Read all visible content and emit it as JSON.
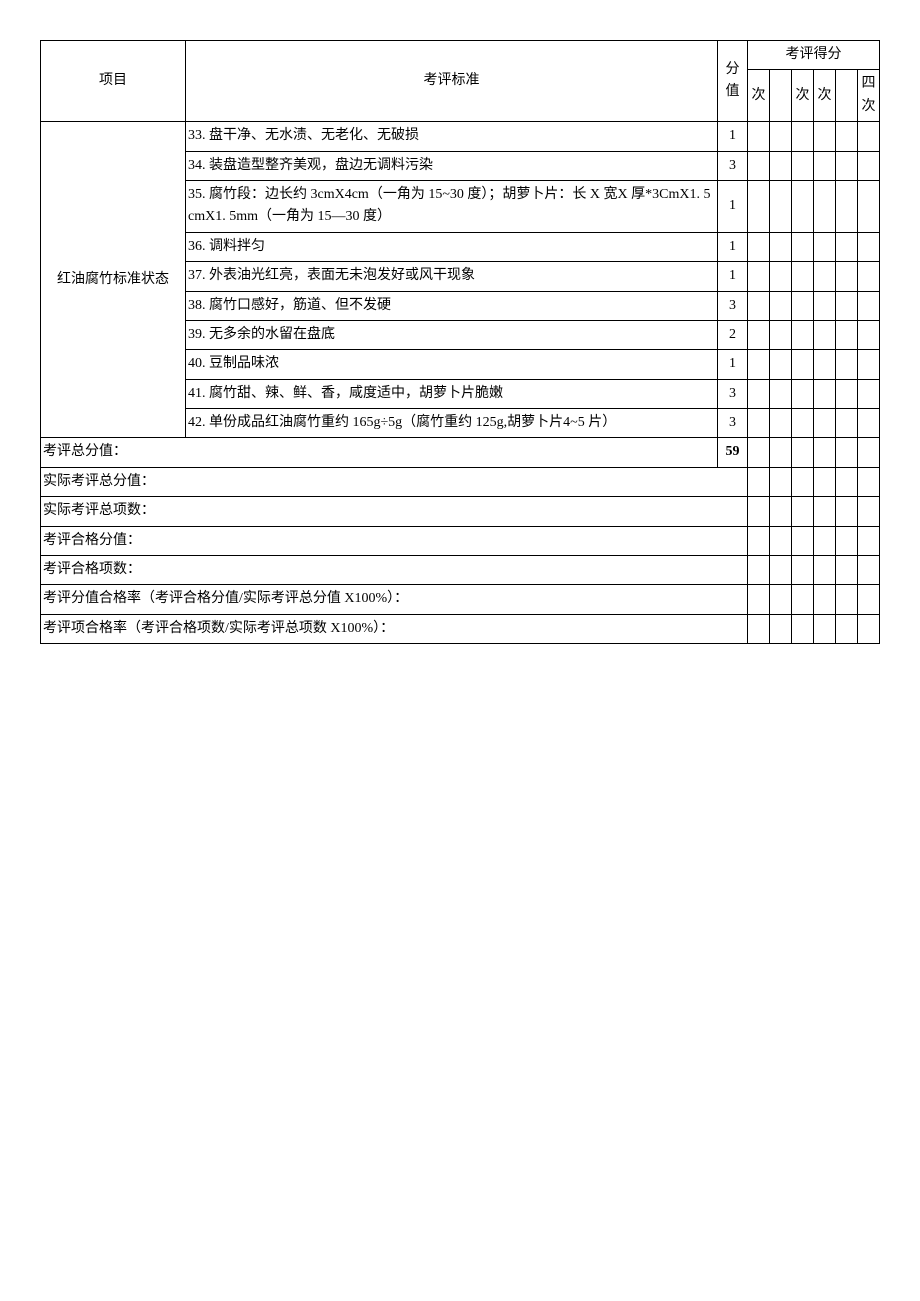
{
  "header": {
    "project": "项目",
    "standard": "考评标准",
    "score": "分值",
    "scoreGroup": "考评得分",
    "col1": "次",
    "col2": "",
    "col3": "次",
    "col4": "次",
    "col5": "",
    "col6": "四次"
  },
  "group": {
    "name": "红油腐竹标准状态"
  },
  "rows": [
    {
      "text": "33. 盘干净、无水渍、无老化、无破损",
      "score": "1"
    },
    {
      "text": "34. 装盘造型整齐美观，盘边无调料污染",
      "score": "3"
    },
    {
      "text": "35. 腐竹段：边长约 3cmX4cm（一角为 15~30 度）；胡萝卜片：长 X 宽X 厚*3CmX1. 5cmX1. 5mm（一角为 15—30 度）",
      "score": "1"
    },
    {
      "text": "36. 调料拌匀",
      "score": "1"
    },
    {
      "text": "37. 外表油光红亮，表面无未泡发好或风干现象",
      "score": "1"
    },
    {
      "text": "38. 腐竹口感好，筋道、但不发硬",
      "score": "3"
    },
    {
      "text": "39. 无多余的水留在盘底",
      "score": "2"
    },
    {
      "text": "40. 豆制品味浓",
      "score": "1"
    },
    {
      "text": "41. 腐竹甜、辣、鲜、香，咸度适中，胡萝卜片脆嫩",
      "score": "3"
    },
    {
      "text": "42. 单份成品红油腐竹重约 165g÷5g（腐竹重约 125g,胡萝卜片4~5 片）",
      "score": "3"
    }
  ],
  "summary": [
    {
      "label": "考评总分值：",
      "score": "59",
      "span": 2,
      "bold": true
    },
    {
      "label": "实际考评总分值：",
      "score": "",
      "span": 3
    },
    {
      "label": "实际考评总项数：",
      "score": "",
      "span": 3
    },
    {
      "label": "考评合格分值：",
      "score": "",
      "span": 3
    },
    {
      "label": "考评合格项数：",
      "score": "",
      "span": 3
    },
    {
      "label": "考评分值合格率（考评合格分值/实际考评总分值 X100%）：",
      "score": "",
      "span": 3
    },
    {
      "label": "考评项合格率（考评合格项数/实际考评总项数 X100%）：",
      "score": "",
      "span": 3
    }
  ]
}
